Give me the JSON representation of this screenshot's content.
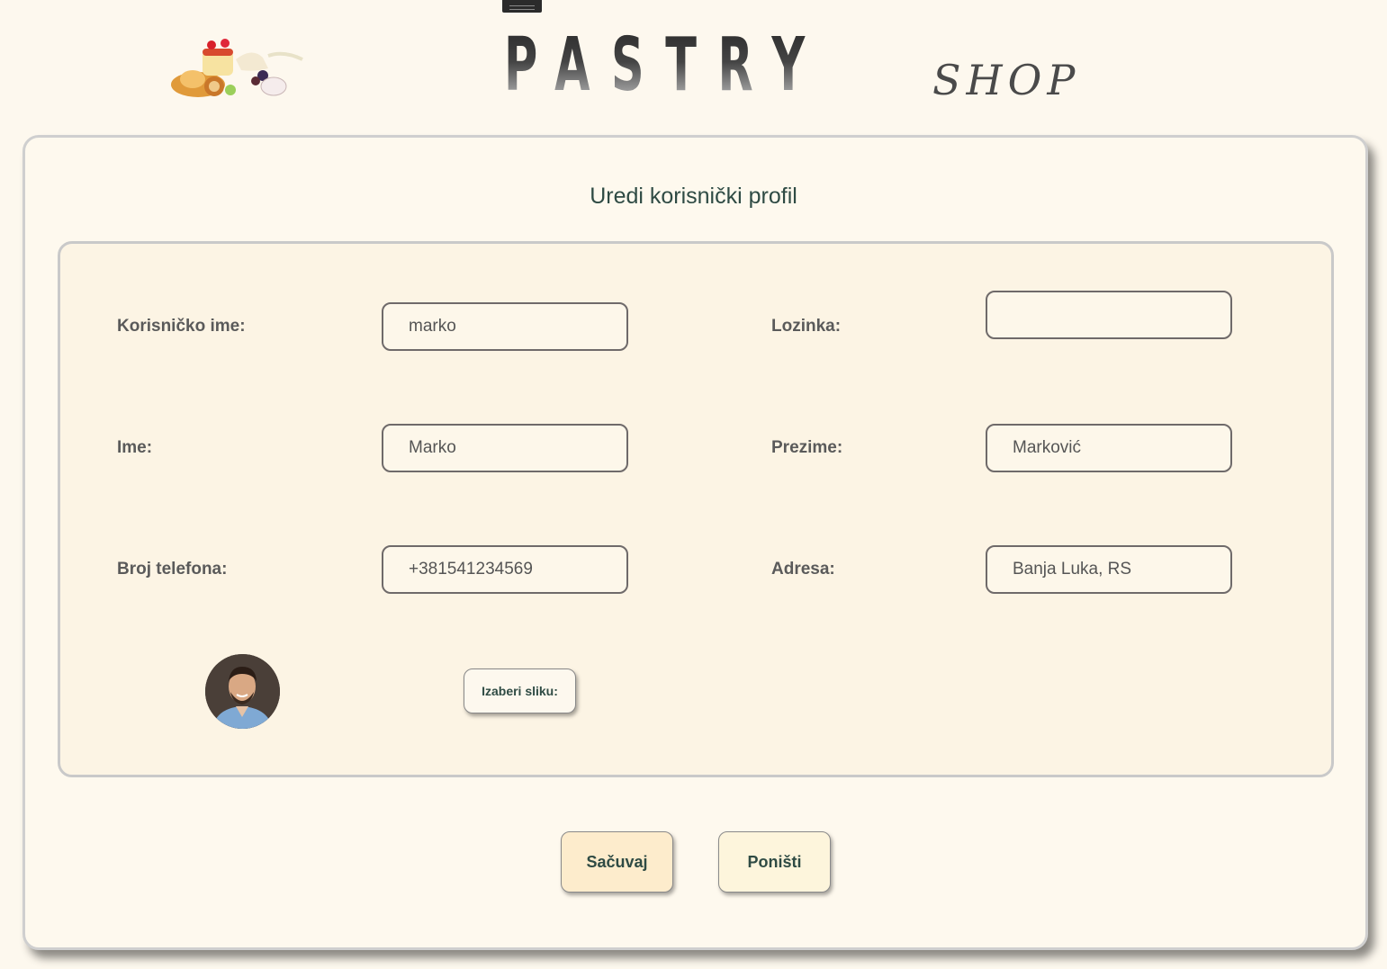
{
  "header": {
    "brand_main": "PASTRY",
    "brand_sub": "SHOP"
  },
  "form": {
    "title": "Uredi korisnički profil",
    "username_label": "Korisničko ime:",
    "username_value": "marko",
    "password_label": "Lozinka:",
    "password_value": "",
    "first_name_label": "Ime:",
    "first_name_value": "Marko",
    "last_name_label": "Prezime:",
    "last_name_value": "Marković",
    "phone_label": "Broj telefona:",
    "phone_value": "+381541234569",
    "address_label": "Adresa:",
    "address_value": "Banja Luka, RS",
    "choose_image_label": "Izaberi sliku:"
  },
  "actions": {
    "save_label": "Sačuvaj",
    "cancel_label": "Poništi"
  }
}
